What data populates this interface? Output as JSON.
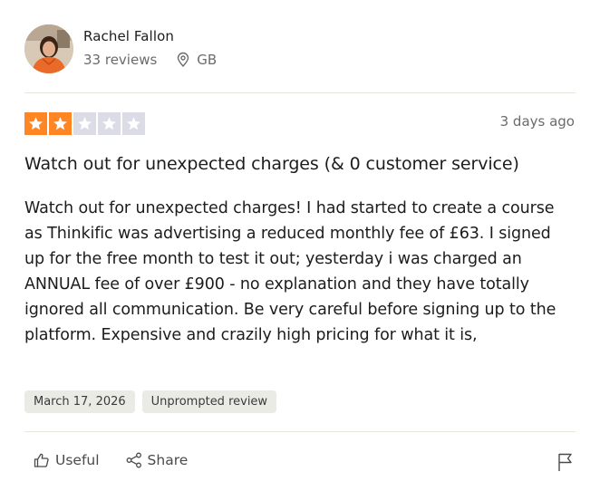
{
  "reviewer": {
    "name": "Rachel Fallon",
    "reviews_count": "33 reviews",
    "country": "GB"
  },
  "review": {
    "rating": 2,
    "rating_max": 5,
    "relative_date": "3 days ago",
    "title": "Watch out for unexpected charges (& 0 customer service)",
    "body": "Watch out for unexpected charges! I had started to create a course as Thinkific was advertising a reduced monthly fee of £63. I signed up for the free month to test it out; yesterday i was charged an ANNUAL fee of over £900 - no explanation and they have totally ignored all communication. Be very careful before signing up to the platform. Expensive and crazily high pricing for what it is,",
    "tags": [
      "March 17, 2026",
      "Unprompted review"
    ]
  },
  "actions": {
    "useful_label": "Useful",
    "share_label": "Share"
  },
  "colors": {
    "star_filled": "#ff8622",
    "star_empty": "#dcdce6",
    "divider": "#e5e5dd",
    "tag_bg": "#ebebe6"
  },
  "icons": [
    "location-pin-icon",
    "star-icon",
    "thumbs-up-icon",
    "share-icon",
    "flag-icon"
  ]
}
